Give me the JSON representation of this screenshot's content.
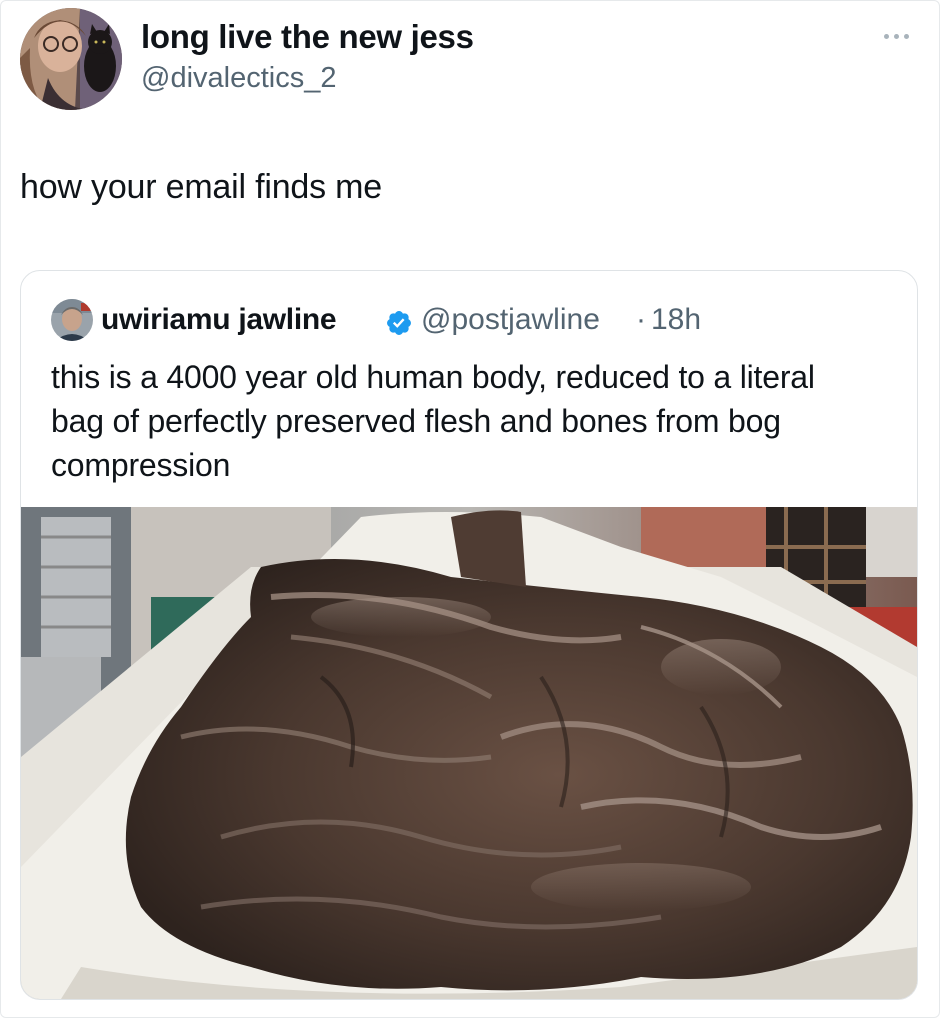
{
  "tweet": {
    "author": {
      "display_name": "long live the new jess",
      "handle": "@divalectics_2"
    },
    "text": "how your email finds me",
    "more_icon": "ellipsis-icon"
  },
  "quoted_tweet": {
    "author": {
      "display_name": "uwiriamu jawline",
      "verified": true,
      "handle": "@postjawline",
      "separator": "·",
      "time": "18h"
    },
    "text": "this is a 4000 year old human body, reduced to a literal bag of perfectly preserved flesh and bones from bog compression",
    "media": "photo"
  },
  "colors": {
    "text_primary": "#0f1419",
    "text_secondary": "#536471",
    "verified_blue": "#1d9bf0",
    "border": "#dfe3e6"
  }
}
